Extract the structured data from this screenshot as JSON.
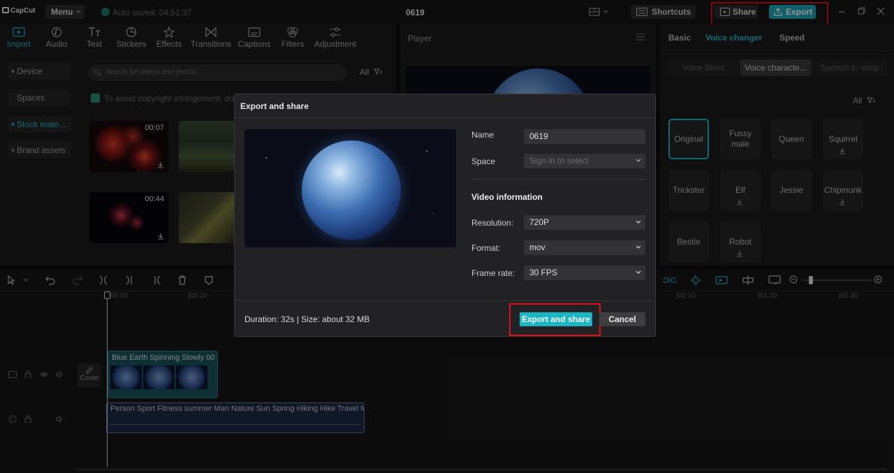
{
  "app": {
    "logo": "CapCut",
    "menu_label": "Menu",
    "autosave": "Auto saved: 04:51:37",
    "project_title": "0619",
    "shortcuts_label": "Shortcuts",
    "share_label": "Share",
    "export_label": "Export"
  },
  "media_tools": [
    {
      "label": "Import",
      "icon": "import-icon",
      "active": true
    },
    {
      "label": "Audio",
      "icon": "audio-icon"
    },
    {
      "label": "Text",
      "icon": "text-icon"
    },
    {
      "label": "Stickers",
      "icon": "sticker-icon"
    },
    {
      "label": "Effects",
      "icon": "effects-icon"
    },
    {
      "label": "Transitions",
      "icon": "transitions-icon"
    },
    {
      "label": "Captions",
      "icon": "captions-icon"
    },
    {
      "label": "Filters",
      "icon": "filters-icon"
    },
    {
      "label": "Adjustment",
      "icon": "adjustment-icon"
    }
  ],
  "sidebar": {
    "items": [
      {
        "label": "Device"
      },
      {
        "label": "Spaces"
      },
      {
        "label": "Stock mate..."
      },
      {
        "label": "Brand assets"
      }
    ]
  },
  "media": {
    "search_placeholder": "Search for videos and photos",
    "filter_label": "All",
    "notice": "To avoid copyright infringement, do n",
    "thumbs": [
      {
        "duration": "00:07"
      },
      {
        "duration": ""
      },
      {
        "duration": "00:44"
      },
      {
        "duration": ""
      }
    ]
  },
  "player": {
    "title": "Player"
  },
  "right_panel": {
    "tabs": [
      "Basic",
      "Voice changer",
      "Speed"
    ],
    "subtabs": [
      "Voice filters",
      "Voice characte...",
      "Speech to song"
    ],
    "filter_label": "All",
    "voices": [
      {
        "label": "Original"
      },
      {
        "label": "Fussy male"
      },
      {
        "label": "Queen"
      },
      {
        "label": "Squirrel"
      },
      {
        "label": "Trickster"
      },
      {
        "label": "Elf"
      },
      {
        "label": "Jessie"
      },
      {
        "label": "Chipmunk"
      },
      {
        "label": "Bestie"
      },
      {
        "label": "Robot"
      }
    ]
  },
  "timeline": {
    "ruler": [
      "00:00",
      "|00:10",
      "|01:10",
      "|01:20",
      "|01:30"
    ],
    "cover_label": "Cover",
    "video_clip_label": "Blue Earth Spinning Slowly   00",
    "audio_clip_label": "Person Sport Fitness summer Man Nature Sun Spring Hiking Hike Travel M"
  },
  "export_dialog": {
    "title": "Export and share",
    "name_label": "Name",
    "name_value": "0619",
    "space_label": "Space",
    "space_value": "Sign in to select",
    "video_info_heading": "Video information",
    "resolution_label": "Resolution:",
    "resolution_value": "720P",
    "format_label": "Format:",
    "format_value": "mov",
    "frame_rate_label": "Frame rate:",
    "frame_rate_value": "30 FPS",
    "footer_info": "Duration: 32s | Size: about 32 MB",
    "export_share_label": "Export and share",
    "cancel_label": "Cancel"
  },
  "colors": {
    "accent": "#1ab6c4",
    "highlight": "#e0101a"
  }
}
